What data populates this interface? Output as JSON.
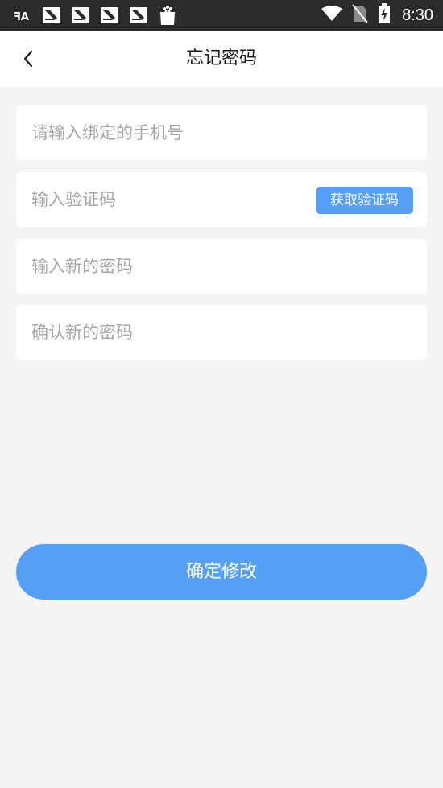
{
  "status_bar": {
    "time": "8:30",
    "notification_icons": [
      "font-app-icon",
      "image-notification-icon",
      "image-notification-icon",
      "image-notification-icon",
      "image-notification-icon",
      "shopping-bag-icon"
    ],
    "system_icons": [
      "wifi-icon",
      "no-sim-icon",
      "battery-charging-icon"
    ]
  },
  "header": {
    "back_icon": "chevron-left-icon",
    "title": "忘记密码"
  },
  "form": {
    "phone_placeholder": "请输入绑定的手机号",
    "code_placeholder": "输入验证码",
    "get_code_label": "获取验证码",
    "new_password_placeholder": "输入新的密码",
    "confirm_password_placeholder": "确认新的密码"
  },
  "submit_label": "确定修改",
  "colors": {
    "accent": "#55a0f5",
    "status_bar": "#2b2b2b",
    "background": "#f4f4f4"
  }
}
